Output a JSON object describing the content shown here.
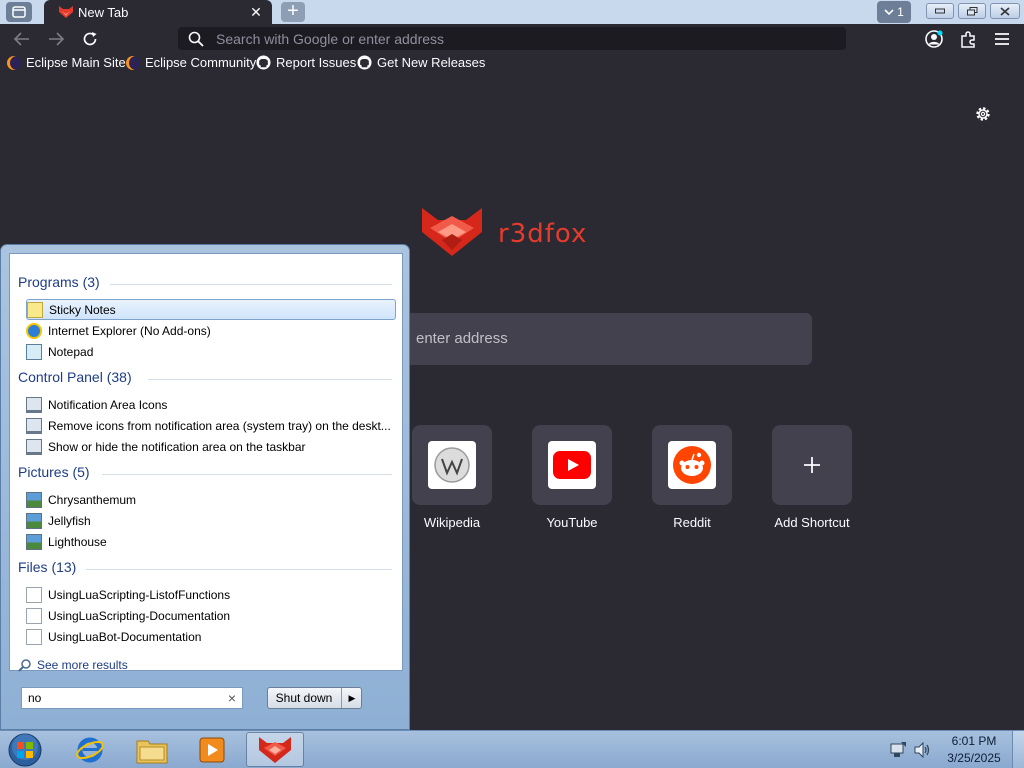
{
  "browser": {
    "tab": {
      "title": "New Tab"
    },
    "tab_count": "1",
    "urlbar": {
      "placeholder": "Search with Google or enter address"
    },
    "bookmarks": [
      {
        "label": "Eclipse Main Site",
        "icon": "eclipse-icon"
      },
      {
        "label": "Eclipse Community",
        "icon": "eclipse-icon"
      },
      {
        "label": "Report Issues",
        "icon": "github-icon"
      },
      {
        "label": "Get New Releases",
        "icon": "github-icon"
      }
    ]
  },
  "newtab": {
    "brand": "r3dfox",
    "search_text": "enter address",
    "shortcuts": [
      {
        "label": "Wikipedia",
        "icon": "wikipedia-icon"
      },
      {
        "label": "YouTube",
        "icon": "youtube-icon"
      },
      {
        "label": "Reddit",
        "icon": "reddit-icon"
      },
      {
        "label": "Add Shortcut",
        "icon": "plus-icon"
      }
    ]
  },
  "start_menu": {
    "sections": [
      {
        "title": "Programs (3)",
        "items": [
          "Sticky Notes",
          "Internet Explorer (No Add-ons)",
          "Notepad"
        ]
      },
      {
        "title": "Control Panel (38)",
        "items": [
          "Notification Area Icons",
          "Remove icons from notification area (system tray) on the deskt...",
          "Show or hide the notification area on the taskbar"
        ]
      },
      {
        "title": "Pictures (5)",
        "items": [
          "Chrysanthemum",
          "Jellyfish",
          "Lighthouse"
        ]
      },
      {
        "title": "Files (13)",
        "items": [
          "UsingLuaScripting-ListofFunctions",
          "UsingLuaScripting-Documentation",
          "UsingLuaBot-Documentation"
        ]
      }
    ],
    "see_more": "See more results",
    "search_value": "no",
    "shutdown_label": "Shut down"
  },
  "taskbar": {
    "time": "6:01 PM",
    "date": "3/25/2025"
  },
  "colors": {
    "browser_bg": "#2b2a33",
    "accent_red": "#e63a2c",
    "start_menu_heading": "#1e3d87"
  }
}
